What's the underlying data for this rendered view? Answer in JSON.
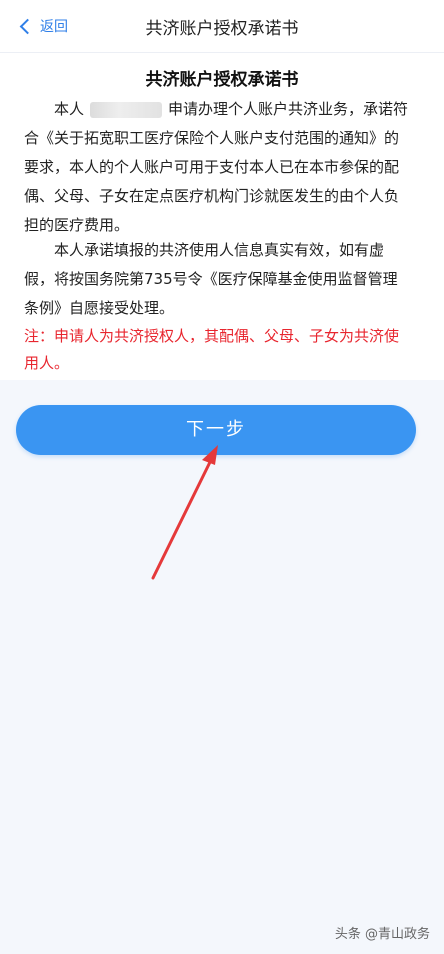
{
  "navbar": {
    "back_label": "返回",
    "title": "共济账户授权承诺书"
  },
  "document": {
    "title": "共济账户授权承诺书",
    "p1_prefix": "本人",
    "p1_rest": "申请办理个人账户共济业务，承诺符合《关于拓宽职工医疗保险个人账户支付范围的通知》的要求，本人的个人账户可用于支付本人已在本市参保的配偶、父母、子女在定点医疗机构门诊就医发生的由个人负担的医疗费用。",
    "p2": "本人承诺填报的共济使用人信息真实有效，如有虚假，将按国务院第735号令《医疗保障基金使用监督管理条例》自愿接受处理。",
    "note": "注：申请人为共济授权人，其配偶、父母、子女为共济使用人。"
  },
  "actions": {
    "next_label": "下一步"
  },
  "watermark": "头条 @青山政务",
  "colors": {
    "accent": "#3a95f2",
    "note_red": "#e8262f",
    "arrow_red": "#e5393a"
  }
}
